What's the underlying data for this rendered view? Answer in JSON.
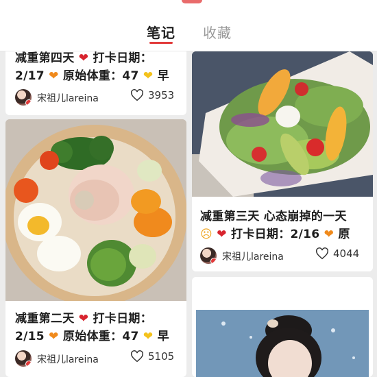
{
  "tabs": [
    {
      "label": "笔记",
      "active": true
    },
    {
      "label": "收藏",
      "active": false
    }
  ],
  "colors": {
    "accent": "#e23a3a",
    "heart_red": "#d8242e",
    "heart_orange": "#f08a1c",
    "heart_yellow": "#f4c21b"
  },
  "cards": [
    {
      "id": "day4",
      "lines": [
        [
          "减重第四天",
          "heart-red-icon",
          "打卡日期："
        ],
        [
          "2/17",
          "heart-orange-icon",
          "原始体重：47",
          "heart-yellow-icon",
          "早"
        ]
      ],
      "author": "宋祖儿lareina",
      "likes": "3953"
    },
    {
      "id": "day3",
      "lines": [
        [
          "减重第三天 心态崩掉的一天"
        ],
        [
          "angry-face-icon",
          "heart-red-icon",
          "打卡日期：2/16",
          "heart-orange-icon",
          "原"
        ]
      ],
      "author": "宋祖儿lareina",
      "likes": "4044"
    },
    {
      "id": "day2",
      "lines": [
        [
          "减重第二天",
          "heart-red-icon",
          "打卡日期："
        ],
        [
          "2/15",
          "heart-orange-icon",
          "原始体重：47",
          "heart-yellow-icon",
          "早"
        ]
      ],
      "author": "宋祖儿lareina",
      "likes": "5105"
    }
  ]
}
